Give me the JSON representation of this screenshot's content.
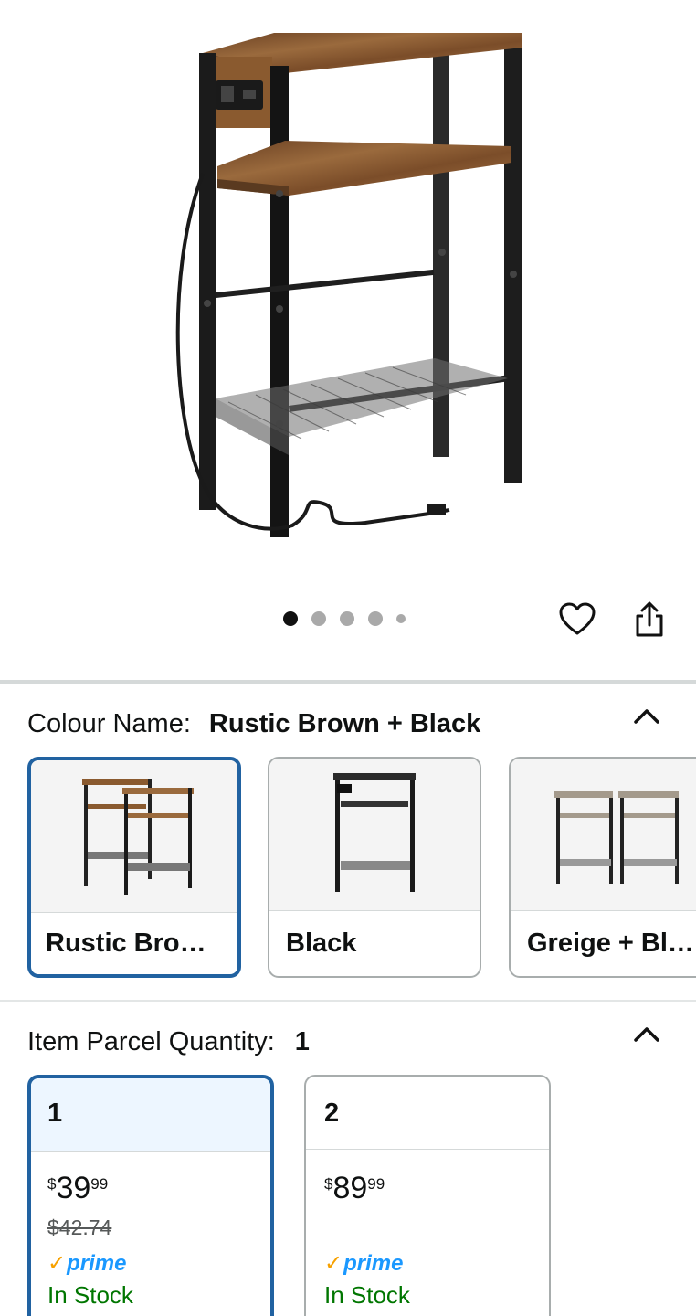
{
  "gallery": {
    "dots_total": 5,
    "active_index": 0,
    "wishlist_icon": "heart-outline-icon",
    "share_icon": "share-icon"
  },
  "colour": {
    "label": "Colour Name:",
    "selected": "Rustic Brown + Black",
    "collapse_icon": "chevron-up-icon",
    "options": [
      {
        "label": "Rustic Bro…",
        "selected": true
      },
      {
        "label": "Black",
        "selected": false
      },
      {
        "label": "Greige + Bl…",
        "selected": false
      }
    ]
  },
  "quantity": {
    "label": "Item Parcel Quantity:",
    "selected": "1",
    "collapse_icon": "chevron-up-icon",
    "options": [
      {
        "qty": "1",
        "currency": "$",
        "price_whole": "39",
        "price_fraction": "99",
        "list_price": "$42.74",
        "prime": "prime",
        "availability": "In Stock",
        "selected": true
      },
      {
        "qty": "2",
        "currency": "$",
        "price_whole": "89",
        "price_fraction": "99",
        "list_price": "",
        "prime": "prime",
        "availability": "In Stock",
        "selected": false
      }
    ]
  },
  "colors": {
    "selected_border": "#2162a1",
    "prime_blue": "#1a98ff",
    "prime_check": "#f7a100",
    "in_stock": "#007600",
    "wood": "#8a5a2f",
    "metal": "#1f1f1f"
  }
}
